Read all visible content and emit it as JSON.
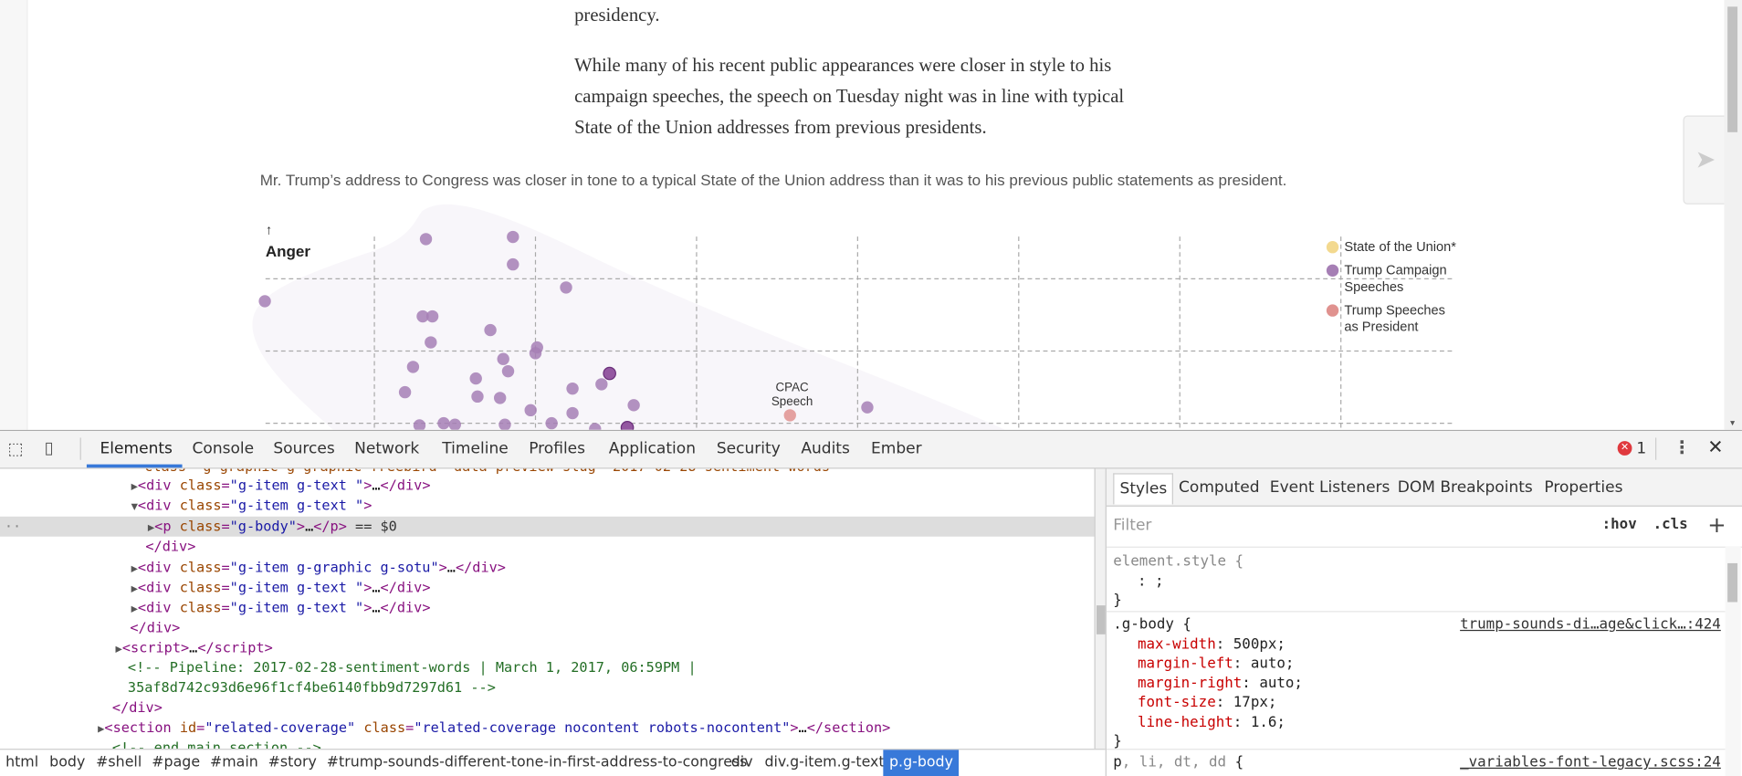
{
  "article": {
    "para1_tail": "presidency.",
    "para2_lines": [
      "While many of his recent public appearances were closer in style to his",
      "campaign speeches, the speech on Tuesday night was in line with typical",
      "State of the Union addresses from previous presidents."
    ],
    "caption": "Mr. Trump’s address to Congress was closer in tone to a typical State of the Union address than it was to his previous public statements as president."
  },
  "chart_data": {
    "type": "scatter",
    "ylabel": "Anger",
    "ylabel_arrow": "↑",
    "grid": true,
    "legend_placement": "right",
    "legend": [
      {
        "label": "State of the Union*",
        "color": "#f3d98f"
      },
      {
        "label_lines": [
          "Trump Campaign",
          "Speeches"
        ],
        "color": "#a67fb5"
      },
      {
        "label_lines": [
          "Trump Speeches",
          "as President"
        ],
        "color": "#e0928f"
      }
    ],
    "annotation": [
      "CPAC",
      "Speech"
    ],
    "series": [
      {
        "name": "Trump Campaign Speeches",
        "color": "#a67fb5",
        "points": [
          [
            1.32,
            2.55
          ],
          [
            1.86,
            2.58
          ],
          [
            1.86,
            2.2
          ],
          [
            0.32,
            1.69
          ],
          [
            2.19,
            1.88
          ],
          [
            1.3,
            1.48
          ],
          [
            1.36,
            1.48
          ],
          [
            1.72,
            1.29
          ],
          [
            1.35,
            1.12
          ],
          [
            2.01,
            1.05
          ],
          [
            2.0,
            0.97
          ],
          [
            1.8,
            0.89
          ],
          [
            1.24,
            0.78
          ],
          [
            1.83,
            0.72
          ],
          [
            1.63,
            0.62
          ],
          [
            2.46,
            0.69
          ],
          [
            2.41,
            0.54
          ],
          [
            2.23,
            0.48
          ],
          [
            1.19,
            0.43
          ],
          [
            1.64,
            0.37
          ],
          [
            1.78,
            0.35
          ],
          [
            2.61,
            0.25
          ],
          [
            1.97,
            0.18
          ],
          [
            4.06,
            0.22
          ],
          [
            1.43,
            0.0
          ],
          [
            1.5,
            -0.02
          ],
          [
            1.28,
            -0.03
          ],
          [
            1.81,
            -0.02
          ],
          [
            2.1,
            0.0
          ],
          [
            2.23,
            0.14
          ],
          [
            2.37,
            -0.08
          ],
          [
            2.57,
            -0.06
          ]
        ]
      },
      {
        "name": "Trump Speeches as President",
        "color": "#e0928f",
        "points": [
          [
            3.58,
            0.11
          ]
        ]
      }
    ],
    "highlight_points": [
      [
        2.46,
        0.69
      ],
      [
        2.57,
        -0.06
      ]
    ]
  },
  "devtools": {
    "tabs": [
      "Elements",
      "Console",
      "Sources",
      "Network",
      "Timeline",
      "Profiles",
      "Application",
      "Security",
      "Audits",
      "Ember"
    ],
    "active_tab": "Elements",
    "error_count": "1",
    "dom_lines": {
      "l0": "class=\"g-graphic g-graphic-freebird\" data-preview-slug=\"2017-02-28-sentiment-words\"",
      "div": "div",
      "class": "class",
      "eq": "=",
      "gtext": "\"g-item g-text \"",
      "ggraphic": "\"g-item g-graphic g-sotu\"",
      "p": "p",
      "gbody": "\"g-body\"",
      "ellipsis": "…",
      "sel_suffix": "== $0",
      "script": "script",
      "comment1": "<!-- Pipeline: 2017-02-28-sentiment-words | March 1, 2017, 06:59PM |",
      "comment2": "35af8d742c93d6e96f1cf4be6140fbb9d7297d61 -->",
      "section": "section",
      "id": "id",
      "related_id": "\"related-coverage\"",
      "related_class": "\"related-coverage nocontent robots-nocontent\"",
      "comment3": "<!-- end main section -->"
    },
    "breadcrumbs": [
      "html",
      "body",
      "#shell",
      "#page",
      "#main",
      "#story",
      "#trump-sounds-different-tone-in-first-address-to-congress",
      "div",
      "div.g-item.g-text",
      "p.g-body"
    ],
    "styles_tabs": [
      "Styles",
      "Computed",
      "Event Listeners",
      "DOM Breakpoints",
      "Properties"
    ],
    "filter_placeholder": "Filter",
    "hov": ":hov",
    "cls": ".cls",
    "plus": "+",
    "rules": {
      "element_style": "element.style {",
      "element_body": ": ;",
      "close": "}",
      "gbody_selector": ".g-body {",
      "gbody_source": "trump-sounds-di…age&click…:424",
      "props": [
        [
          "max-width",
          "500px;"
        ],
        [
          "margin-left",
          "auto;"
        ],
        [
          "margin-right",
          "auto;"
        ],
        [
          "font-size",
          "17px;"
        ],
        [
          "line-height",
          "1.6;"
        ]
      ],
      "p_selector_main": "p",
      "p_selector_rest": ", li, dt, dd",
      "brace": " {",
      "p_source": "_variables-font-legacy.scss:24"
    }
  }
}
